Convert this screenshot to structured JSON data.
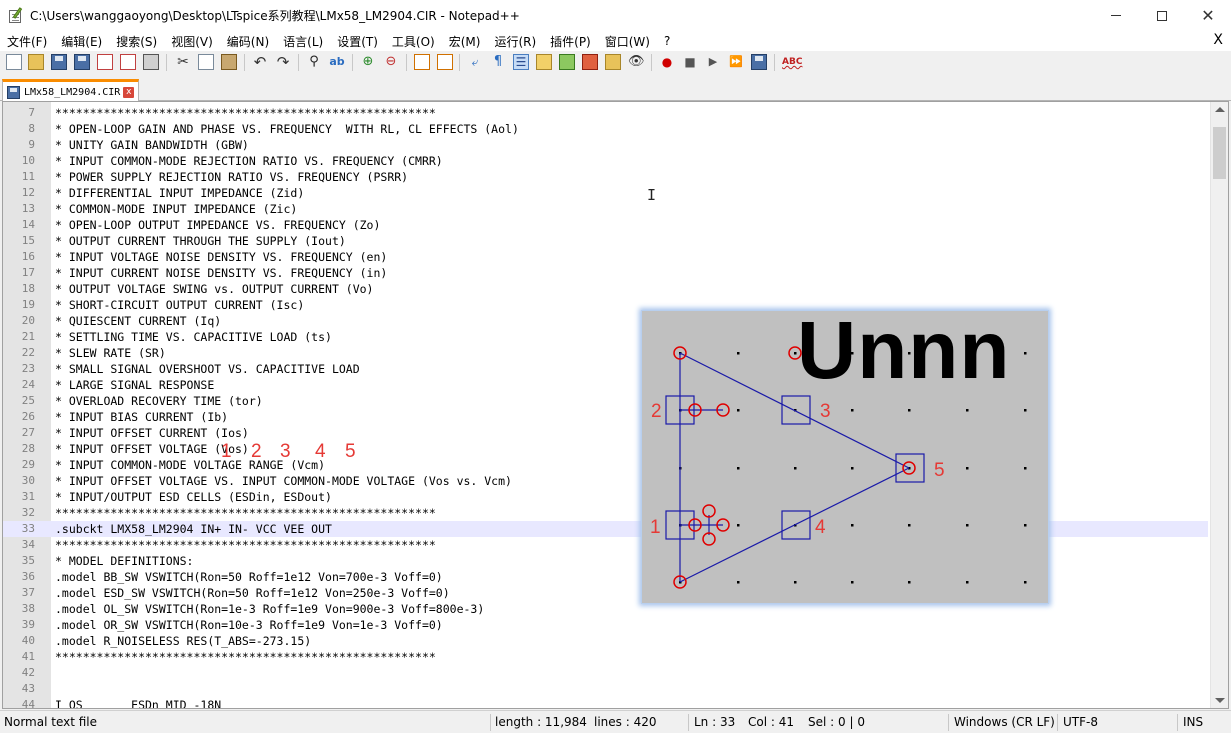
{
  "window": {
    "title": "C:\\Users\\wanggaoyong\\Desktop\\LTspice系列教程\\LMx58_LM2904.CIR - Notepad++"
  },
  "menu": [
    "文件(F)",
    "编辑(E)",
    "搜索(S)",
    "视图(V)",
    "编码(N)",
    "语言(L)",
    "设置(T)",
    "工具(O)",
    "宏(M)",
    "运行(R)",
    "插件(P)",
    "窗口(W)",
    "?"
  ],
  "menu_close": "X",
  "toolbar": {
    "icons": [
      "new-file-icon",
      "open-file-icon",
      "save-icon",
      "save-all-icon",
      "close-icon",
      "close-all-icon",
      "print-icon",
      "cut-icon",
      "copy-icon",
      "paste-icon",
      "undo-icon",
      "redo-icon",
      "find-icon",
      "replace-icon",
      "zoom-in-icon",
      "zoom-out-icon",
      "sync-vertical-icon",
      "sync-horizontal-icon",
      "word-wrap-icon",
      "show-all-chars-icon",
      "indent-guide-icon",
      "user-language-icon",
      "doc-map-icon",
      "function-list-icon",
      "folder-workspace-icon",
      "monitoring-icon",
      "record-macro-icon",
      "stop-macro-icon",
      "play-macro-icon",
      "run-macro-multiple-icon",
      "save-macro-icon",
      "spell-check-icon"
    ]
  },
  "tab": {
    "label": "LMx58_LM2904.CIR",
    "close": "x"
  },
  "editor": {
    "current_line": 33,
    "lines": [
      {
        "n": "7",
        "text": "*******************************************************"
      },
      {
        "n": "8",
        "text": "* OPEN-LOOP GAIN AND PHASE VS. FREQUENCY  WITH RL, CL EFFECTS (Aol)"
      },
      {
        "n": "9",
        "text": "* UNITY GAIN BANDWIDTH (GBW)"
      },
      {
        "n": "10",
        "text": "* INPUT COMMON-MODE REJECTION RATIO VS. FREQUENCY (CMRR)"
      },
      {
        "n": "11",
        "text": "* POWER SUPPLY REJECTION RATIO VS. FREQUENCY (PSRR)"
      },
      {
        "n": "12",
        "text": "* DIFFERENTIAL INPUT IMPEDANCE (Zid)"
      },
      {
        "n": "13",
        "text": "* COMMON-MODE INPUT IMPEDANCE (Zic)"
      },
      {
        "n": "14",
        "text": "* OPEN-LOOP OUTPUT IMPEDANCE VS. FREQUENCY (Zo)"
      },
      {
        "n": "15",
        "text": "* OUTPUT CURRENT THROUGH THE SUPPLY (Iout)"
      },
      {
        "n": "16",
        "text": "* INPUT VOLTAGE NOISE DENSITY VS. FREQUENCY (en)"
      },
      {
        "n": "17",
        "text": "* INPUT CURRENT NOISE DENSITY VS. FREQUENCY (in)"
      },
      {
        "n": "18",
        "text": "* OUTPUT VOLTAGE SWING vs. OUTPUT CURRENT (Vo)"
      },
      {
        "n": "19",
        "text": "* SHORT-CIRCUIT OUTPUT CURRENT (Isc)"
      },
      {
        "n": "20",
        "text": "* QUIESCENT CURRENT (Iq)"
      },
      {
        "n": "21",
        "text": "* SETTLING TIME VS. CAPACITIVE LOAD (ts)"
      },
      {
        "n": "22",
        "text": "* SLEW RATE (SR)"
      },
      {
        "n": "23",
        "text": "* SMALL SIGNAL OVERSHOOT VS. CAPACITIVE LOAD"
      },
      {
        "n": "24",
        "text": "* LARGE SIGNAL RESPONSE"
      },
      {
        "n": "25",
        "text": "* OVERLOAD RECOVERY TIME (tor)"
      },
      {
        "n": "26",
        "text": "* INPUT BIAS CURRENT (Ib)"
      },
      {
        "n": "27",
        "text": "* INPUT OFFSET CURRENT (Ios)"
      },
      {
        "n": "28",
        "text": "* INPUT OFFSET VOLTAGE (Vos)"
      },
      {
        "n": "29",
        "text": "* INPUT COMMON-MODE VOLTAGE RANGE (Vcm)"
      },
      {
        "n": "30",
        "text": "* INPUT OFFSET VOLTAGE VS. INPUT COMMON-MODE VOLTAGE (Vos vs. Vcm)"
      },
      {
        "n": "31",
        "text": "* INPUT/OUTPUT ESD CELLS (ESDin, ESDout)"
      },
      {
        "n": "32",
        "text": "*******************************************************"
      },
      {
        "n": "33",
        "text": ".subckt LMX58_LM2904 IN+ IN- VCC VEE OUT"
      },
      {
        "n": "34",
        "text": "*******************************************************"
      },
      {
        "n": "35",
        "text": "* MODEL DEFINITIONS:"
      },
      {
        "n": "36",
        "text": ".model BB_SW VSWITCH(Ron=50 Roff=1e12 Von=700e-3 Voff=0)"
      },
      {
        "n": "37",
        "text": ".model ESD_SW VSWITCH(Ron=50 Roff=1e12 Von=250e-3 Voff=0)"
      },
      {
        "n": "38",
        "text": ".model OL_SW VSWITCH(Ron=1e-3 Roff=1e9 Von=900e-3 Voff=800e-3)"
      },
      {
        "n": "39",
        "text": ".model OR_SW VSWITCH(Ron=10e-3 Roff=1e9 Von=1e-3 Voff=0)"
      },
      {
        "n": "40",
        "text": ".model R_NOISELESS RES(T_ABS=-273.15)"
      },
      {
        "n": "41",
        "text": "*******************************************************"
      },
      {
        "n": "42",
        "text": ""
      },
      {
        "n": "43",
        "text": ""
      },
      {
        "n": "44",
        "text": "I_OS       ESDn_MID -18N"
      }
    ]
  },
  "annotation": {
    "pin_numbers": [
      "1",
      "2",
      "3",
      "4",
      "5"
    ]
  },
  "overlay": {
    "big_label": "Unnn",
    "pin_labels": [
      "1",
      "2",
      "3",
      "4",
      "5"
    ],
    "colors": {
      "background": "#c0c0c0",
      "wire": "#1a1aa8",
      "pin_marker": "#e00000",
      "label": "#e53935"
    }
  },
  "statusbar": {
    "file_type": "Normal text file",
    "length": "length : 11,984",
    "lines": "lines : 420",
    "ln": "Ln : 33",
    "col": "Col : 41",
    "sel": "Sel : 0 | 0",
    "eol": "Windows (CR LF)",
    "encoding": "UTF-8",
    "mode": "INS"
  }
}
